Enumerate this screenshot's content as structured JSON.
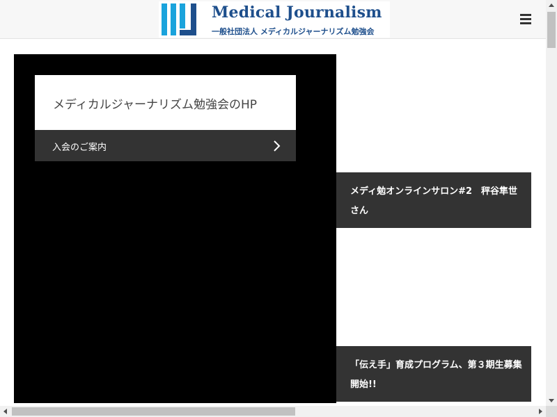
{
  "header": {
    "logo": {
      "title": "Medical Journalism",
      "subtitle": "一般社団法人 メディカルジャーナリズム勉強会",
      "colors": {
        "blue_dark": "#1e4f8c",
        "blue_light": "#1aa3dc"
      }
    },
    "menu_icon": "hamburger-menu-icon"
  },
  "hero": {
    "card_title": "メディカルジャーナリズム勉強会のHP",
    "link_label": "入会のご案内",
    "link_icon": "chevron-right-icon"
  },
  "articles": [
    {
      "title": "メディ勉オンラインサロン#2　秤谷隼世さん"
    },
    {
      "title": "「伝え手」育成プログラム、第３期生募集開始!!"
    }
  ],
  "colors": {
    "hero_background": "#000000",
    "dark_panel": "#333333",
    "header_background": "#f7f7f7"
  }
}
